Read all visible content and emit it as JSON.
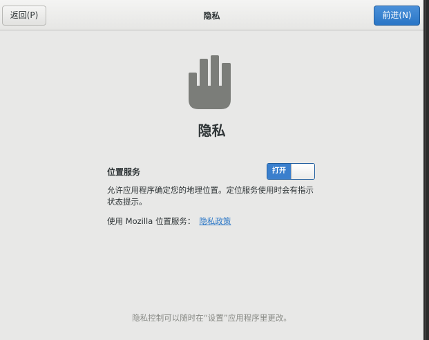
{
  "header": {
    "back_label": "返回(P)",
    "title": "隐私",
    "next_label": "前进(N)"
  },
  "main": {
    "icon": "hand-stop-icon",
    "heading": "隐私",
    "location": {
      "label": "位置服务",
      "toggle_text": "打开",
      "toggle_state": "on",
      "description": "允许应用程序确定您的地理位置。定位服务使用时会有指示状态提示。",
      "mozilla_prefix": "使用  Mozilla 位置服务：",
      "policy_link": "隐私政策"
    }
  },
  "footer": {
    "note": "隐私控制可以随时在“设置”应用程序里更改。"
  },
  "colors": {
    "accent": "#2a76c6",
    "window_bg": "#e8e8e7",
    "icon_gray": "#7b7d79"
  }
}
